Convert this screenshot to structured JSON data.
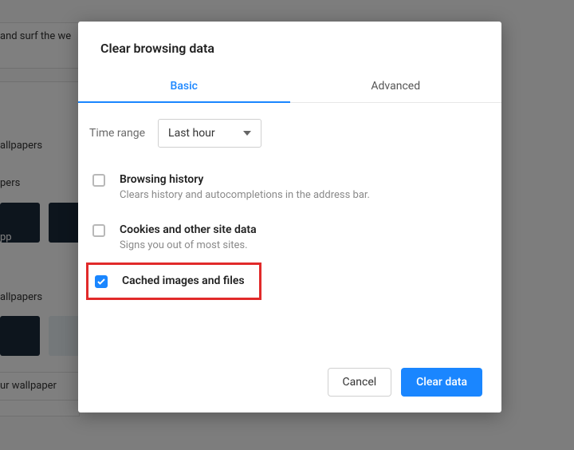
{
  "background": {
    "line1": "and surf the we",
    "wallpapers": "allpapers",
    "pers": "pers",
    "pp": "pp",
    "wallpapers2": "allpapers",
    "wallpaper_btn": "ur wallpaper"
  },
  "dialog": {
    "title": "Clear browsing data",
    "tabs": {
      "basic": "Basic",
      "advanced": "Advanced"
    },
    "time_range_label": "Time range",
    "time_range_value": "Last hour",
    "options": [
      {
        "title": "Browsing history",
        "sub": "Clears history and autocompletions in the address bar.",
        "checked": false
      },
      {
        "title": "Cookies and other site data",
        "sub": "Signs you out of most sites.",
        "checked": false
      },
      {
        "title": "Cached images and files",
        "sub": "",
        "checked": true
      }
    ],
    "buttons": {
      "cancel": "Cancel",
      "clear": "Clear data"
    }
  }
}
